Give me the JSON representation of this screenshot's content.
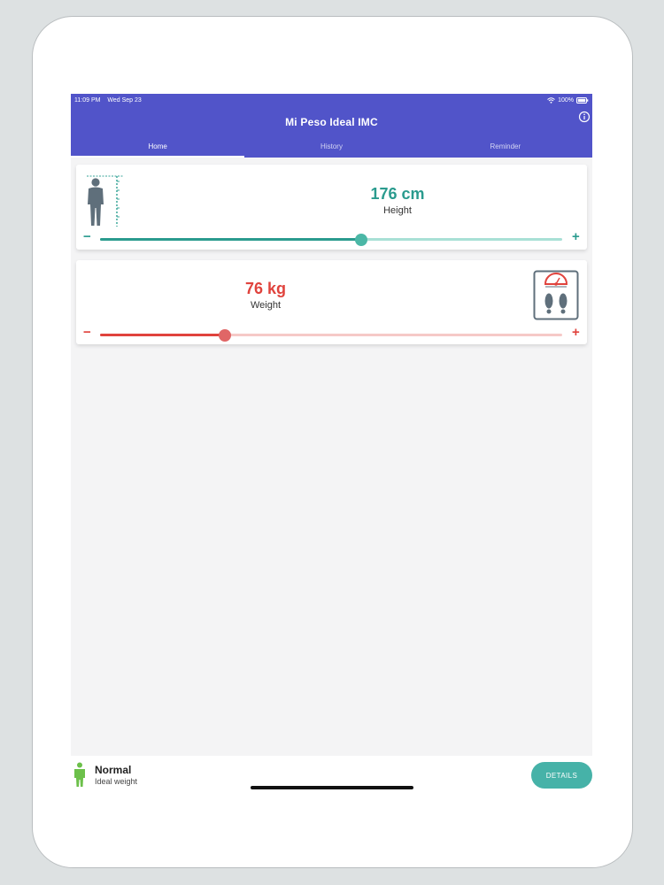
{
  "status_bar": {
    "time": "11:09 PM",
    "date": "Wed Sep 23",
    "battery": "100%"
  },
  "app_bar": {
    "title": "Mi Peso Ideal IMC"
  },
  "tabs": [
    {
      "label": "Home",
      "active": true
    },
    {
      "label": "History",
      "active": false
    },
    {
      "label": "Reminder",
      "active": false
    }
  ],
  "height_card": {
    "value": "176 cm",
    "label": "Height",
    "minus": "−",
    "plus": "+",
    "slider_fraction": 0.565,
    "color": "#2a9b8e",
    "track_color": "#a8e0d6",
    "thumb_color": "#4bb7a6",
    "icon": "person-height-icon"
  },
  "weight_card": {
    "value": "76 kg",
    "label": "Weight",
    "minus": "−",
    "plus": "+",
    "slider_fraction": 0.27,
    "color": "#e0433d",
    "track_color": "#f6c9c7",
    "thumb_color": "#e06666",
    "icon": "bathroom-scale-icon"
  },
  "result": {
    "title": "Normal",
    "subtitle": "Ideal weight",
    "icon": "person-icon",
    "icon_color": "#6cc04a"
  },
  "details_button": {
    "label": "DETAILS"
  },
  "colors": {
    "primary": "#5154c9",
    "accent": "#46b2a8"
  }
}
